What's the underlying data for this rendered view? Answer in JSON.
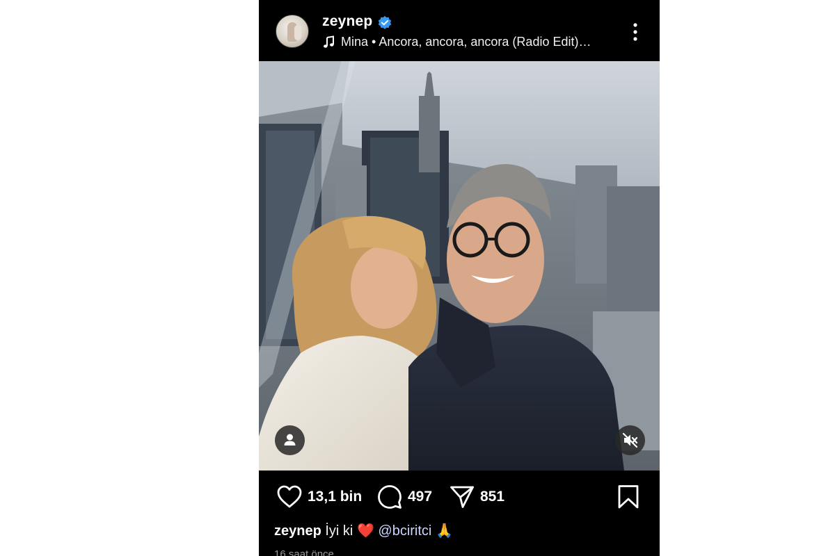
{
  "post": {
    "username": "zeynep",
    "song": "Mina • Ancora, ancora, ancora (Radio Edit)…",
    "icons": {
      "verified": "verified-badge-icon",
      "music": "music-note-icon",
      "more": "more-options-icon",
      "user_tag": "user-tag-icon",
      "mute": "speaker-muted-icon",
      "like": "heart-icon",
      "comment": "comment-icon",
      "share": "paper-plane-icon",
      "save": "bookmark-icon"
    },
    "colors": {
      "background": "#000000",
      "verified": "#3897f0",
      "mention": "#c9d6ff",
      "heart_emoji": "#e0245e"
    }
  },
  "actions": {
    "likes": "13,1 bin",
    "comments": "497",
    "shares": "851"
  },
  "caption": {
    "username": "zeynep",
    "text": "İyi ki",
    "heart": "❤️",
    "mention": "@bciritci",
    "pray": "🙏"
  },
  "time": "16 saat önce"
}
